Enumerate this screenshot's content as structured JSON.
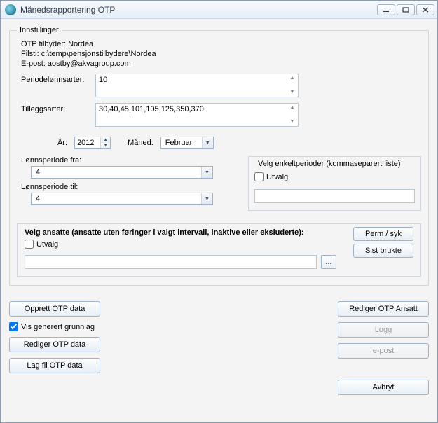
{
  "window": {
    "title": "Månedsrapportering OTP"
  },
  "settings": {
    "legend": "Innstillinger",
    "provider_label": "OTP tilbyder:",
    "provider_value": "Nordea",
    "path_label": "Filsti:",
    "path_value": "c:\\temp\\pensjonstilbydere\\Nordea",
    "email_label": "E-post:",
    "email_value": "aostby@akvagroup.com",
    "periodelonn_label": "Periodelønnsarter:",
    "periodelonn_value": "10",
    "tillegg_label": "Tilleggsarter:",
    "tillegg_value": "30,40,45,101,105,125,350,370",
    "year_label": "År:",
    "year_value": "2012",
    "month_label": "Måned:",
    "month_value": "Februar",
    "lperiod_from_label": "Lønnsperiode fra:",
    "lperiod_from_value": "4",
    "lperiod_to_label": "Lønnsperiode til:",
    "lperiod_to_value": "4",
    "single_periods_label": "Velg enkeltperioder (kommaseparert liste)",
    "utvalg_checkbox": "Utvalg",
    "single_periods_value": ""
  },
  "employees": {
    "heading": "Velg ansatte (ansatte uten føringer i valgt intervall, inaktive eller eksluderte):",
    "utvalg_checkbox": "Utvalg",
    "filter_value": "",
    "browse": "...",
    "perm_syk": "Perm / syk",
    "sist_brukte": "Sist brukte"
  },
  "actions": {
    "opprett": "Opprett OTP data",
    "vis_grunnlag": "Vis generert grunnlag",
    "rediger_data": "Rediger OTP data",
    "lag_fil": "Lag fil OTP data",
    "rediger_ansatt": "Rediger OTP Ansatt",
    "logg": "Logg",
    "epost": "e-post",
    "avbryt": "Avbryt"
  }
}
